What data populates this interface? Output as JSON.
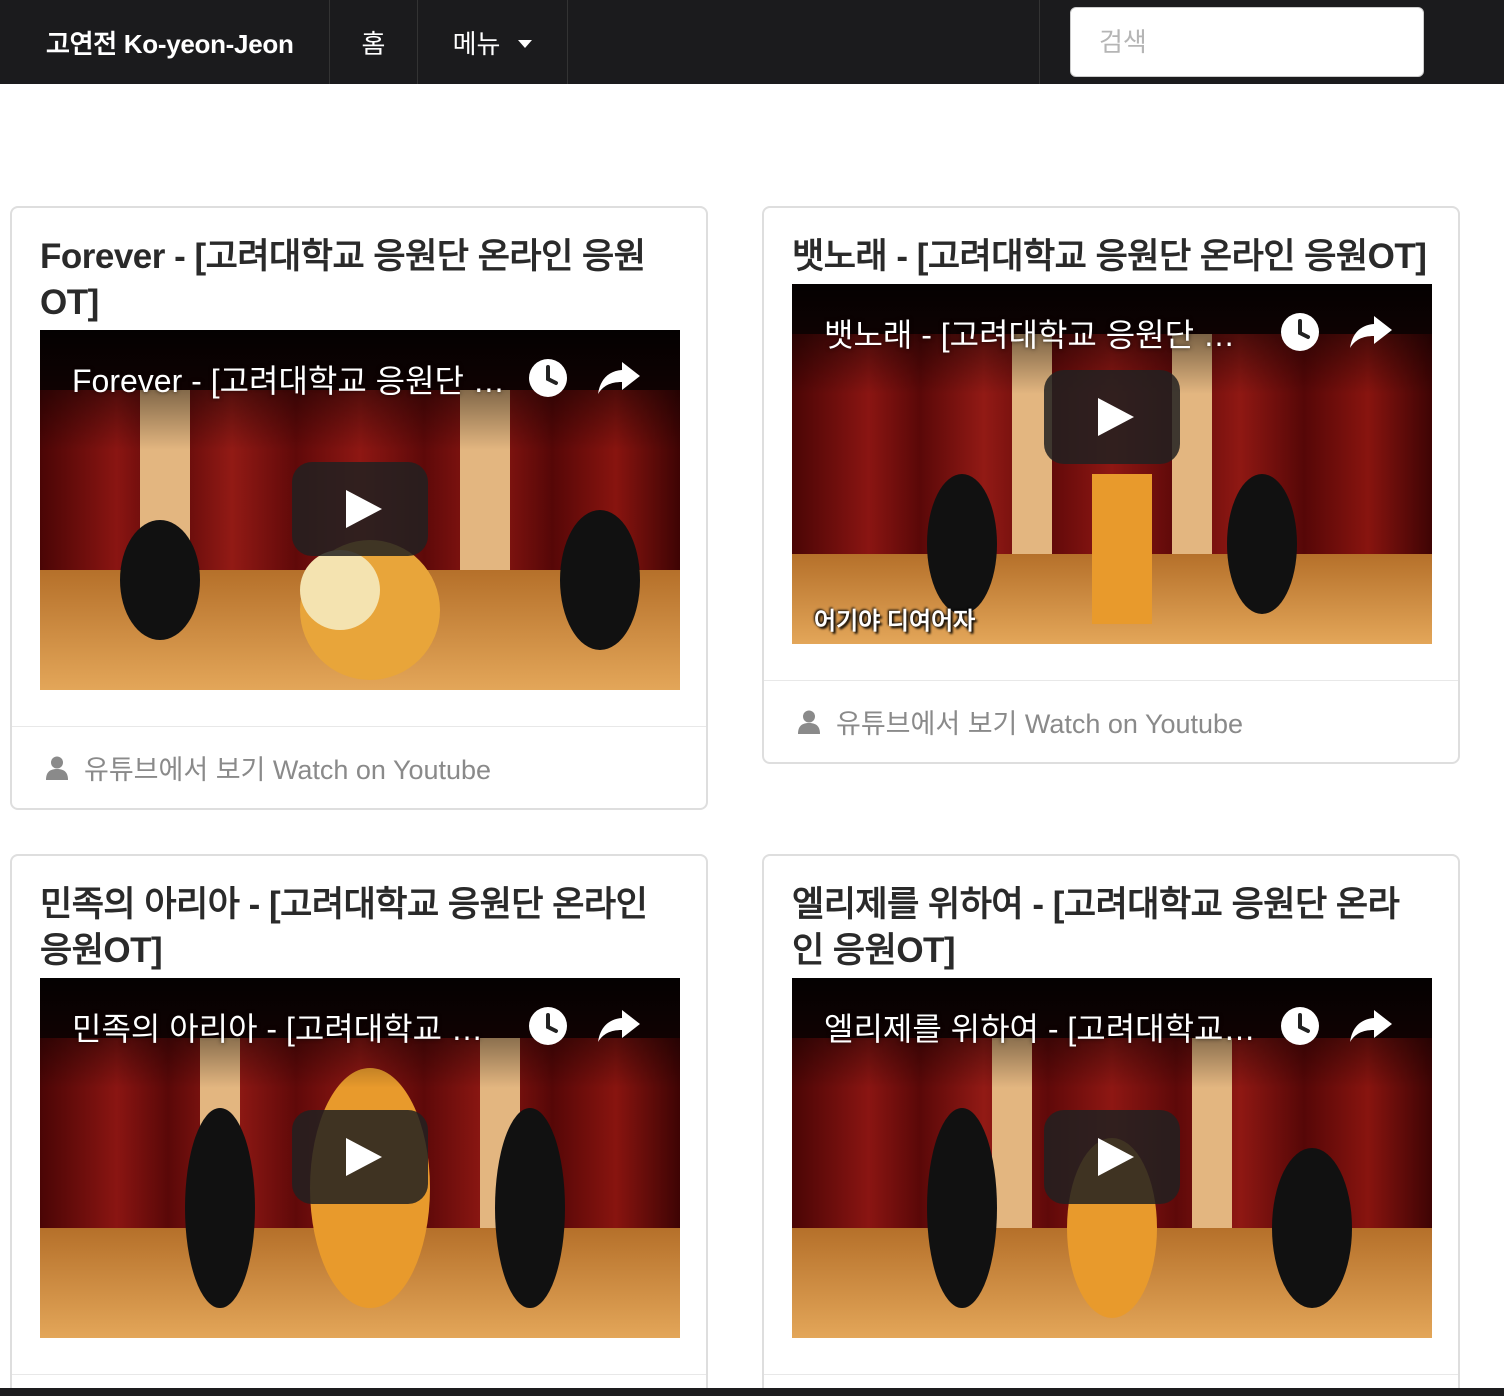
{
  "navbar": {
    "brand": "고연전 Ko-yeon-Jeon",
    "home": "홈",
    "menu": "메뉴",
    "search_placeholder": "검색"
  },
  "videos": [
    {
      "card_title": "Forever - [고려대학교 응원단 온라인 응원OT]",
      "video_title": "Forever - [고려대학교 응원단 온라인 응원OT]",
      "subtitle": "",
      "footer": "유튜브에서 보기 Watch on Youtube"
    },
    {
      "card_title": "뱃노래 - [고려대학교 응원단 온라인 응원OT]",
      "video_title": "뱃노래 - [고려대학교 응원단 온라인 응원OT]",
      "subtitle": "어기야 디여어자",
      "footer": "유튜브에서 보기 Watch on Youtube"
    },
    {
      "card_title": "민족의 아리아 - [고려대학교 응원단 온라인 응원OT]",
      "video_title": "민족의 아리아 - [고려대학교 응원단 온라인 응원OT]",
      "subtitle": "",
      "footer": ""
    },
    {
      "card_title": "엘리제를 위하여 - [고려대학교 응원단 온라인 응원OT]",
      "video_title": "엘리제를 위하여 - [고려대학교 응원단 온라인 응원OT]",
      "subtitle": "",
      "footer": ""
    }
  ],
  "icons": {
    "dropdown": "caret-down-icon",
    "watch_later": "clock-icon",
    "share": "share-icon",
    "play": "play-icon",
    "author": "user-icon"
  },
  "colors": {
    "navbar_bg": "#1b1b1d",
    "play_button": "#212121",
    "stage_curtain": "#7a0f10",
    "stage_floor": "#c98b3a"
  }
}
